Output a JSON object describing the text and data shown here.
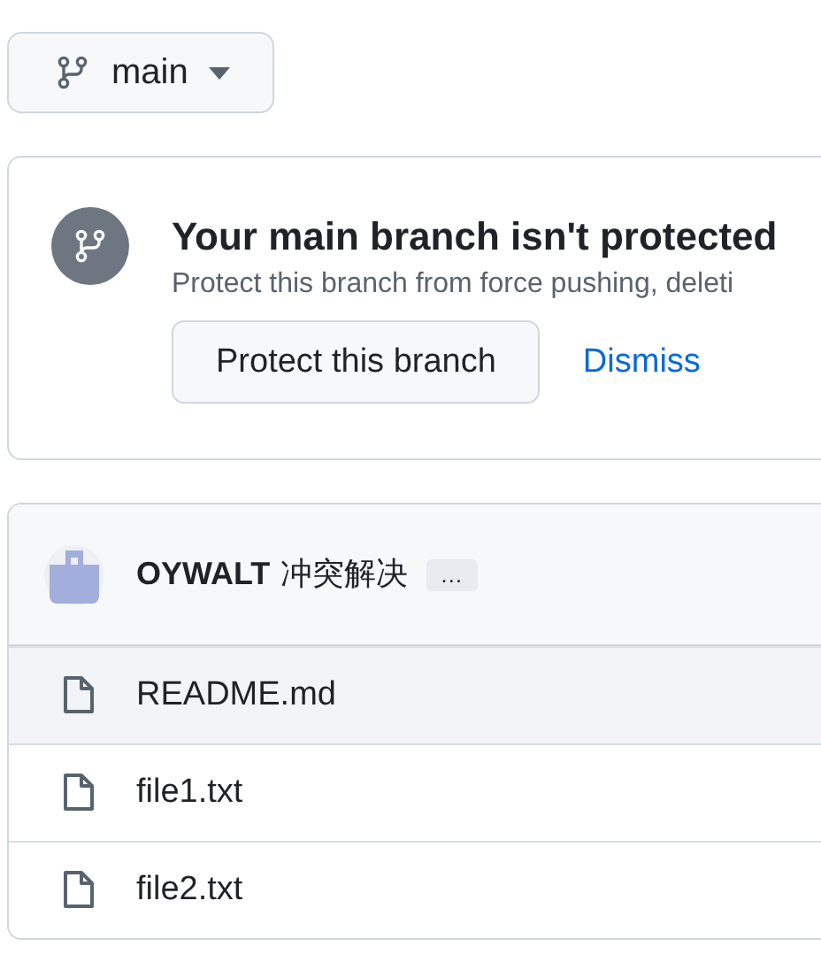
{
  "branch_button": {
    "label": "main"
  },
  "protection_notice": {
    "title": "Your main branch isn't protected",
    "description": "Protect this branch from force pushing, deleti",
    "primary_button": "Protect this branch",
    "dismiss_link": "Dismiss"
  },
  "commit": {
    "author": "OYWALT",
    "message": "冲突解决",
    "more_button": "…"
  },
  "files": [
    {
      "name": "README.md",
      "highlighted": true
    },
    {
      "name": "file1.txt",
      "highlighted": false
    },
    {
      "name": "file2.txt",
      "highlighted": false
    }
  ]
}
